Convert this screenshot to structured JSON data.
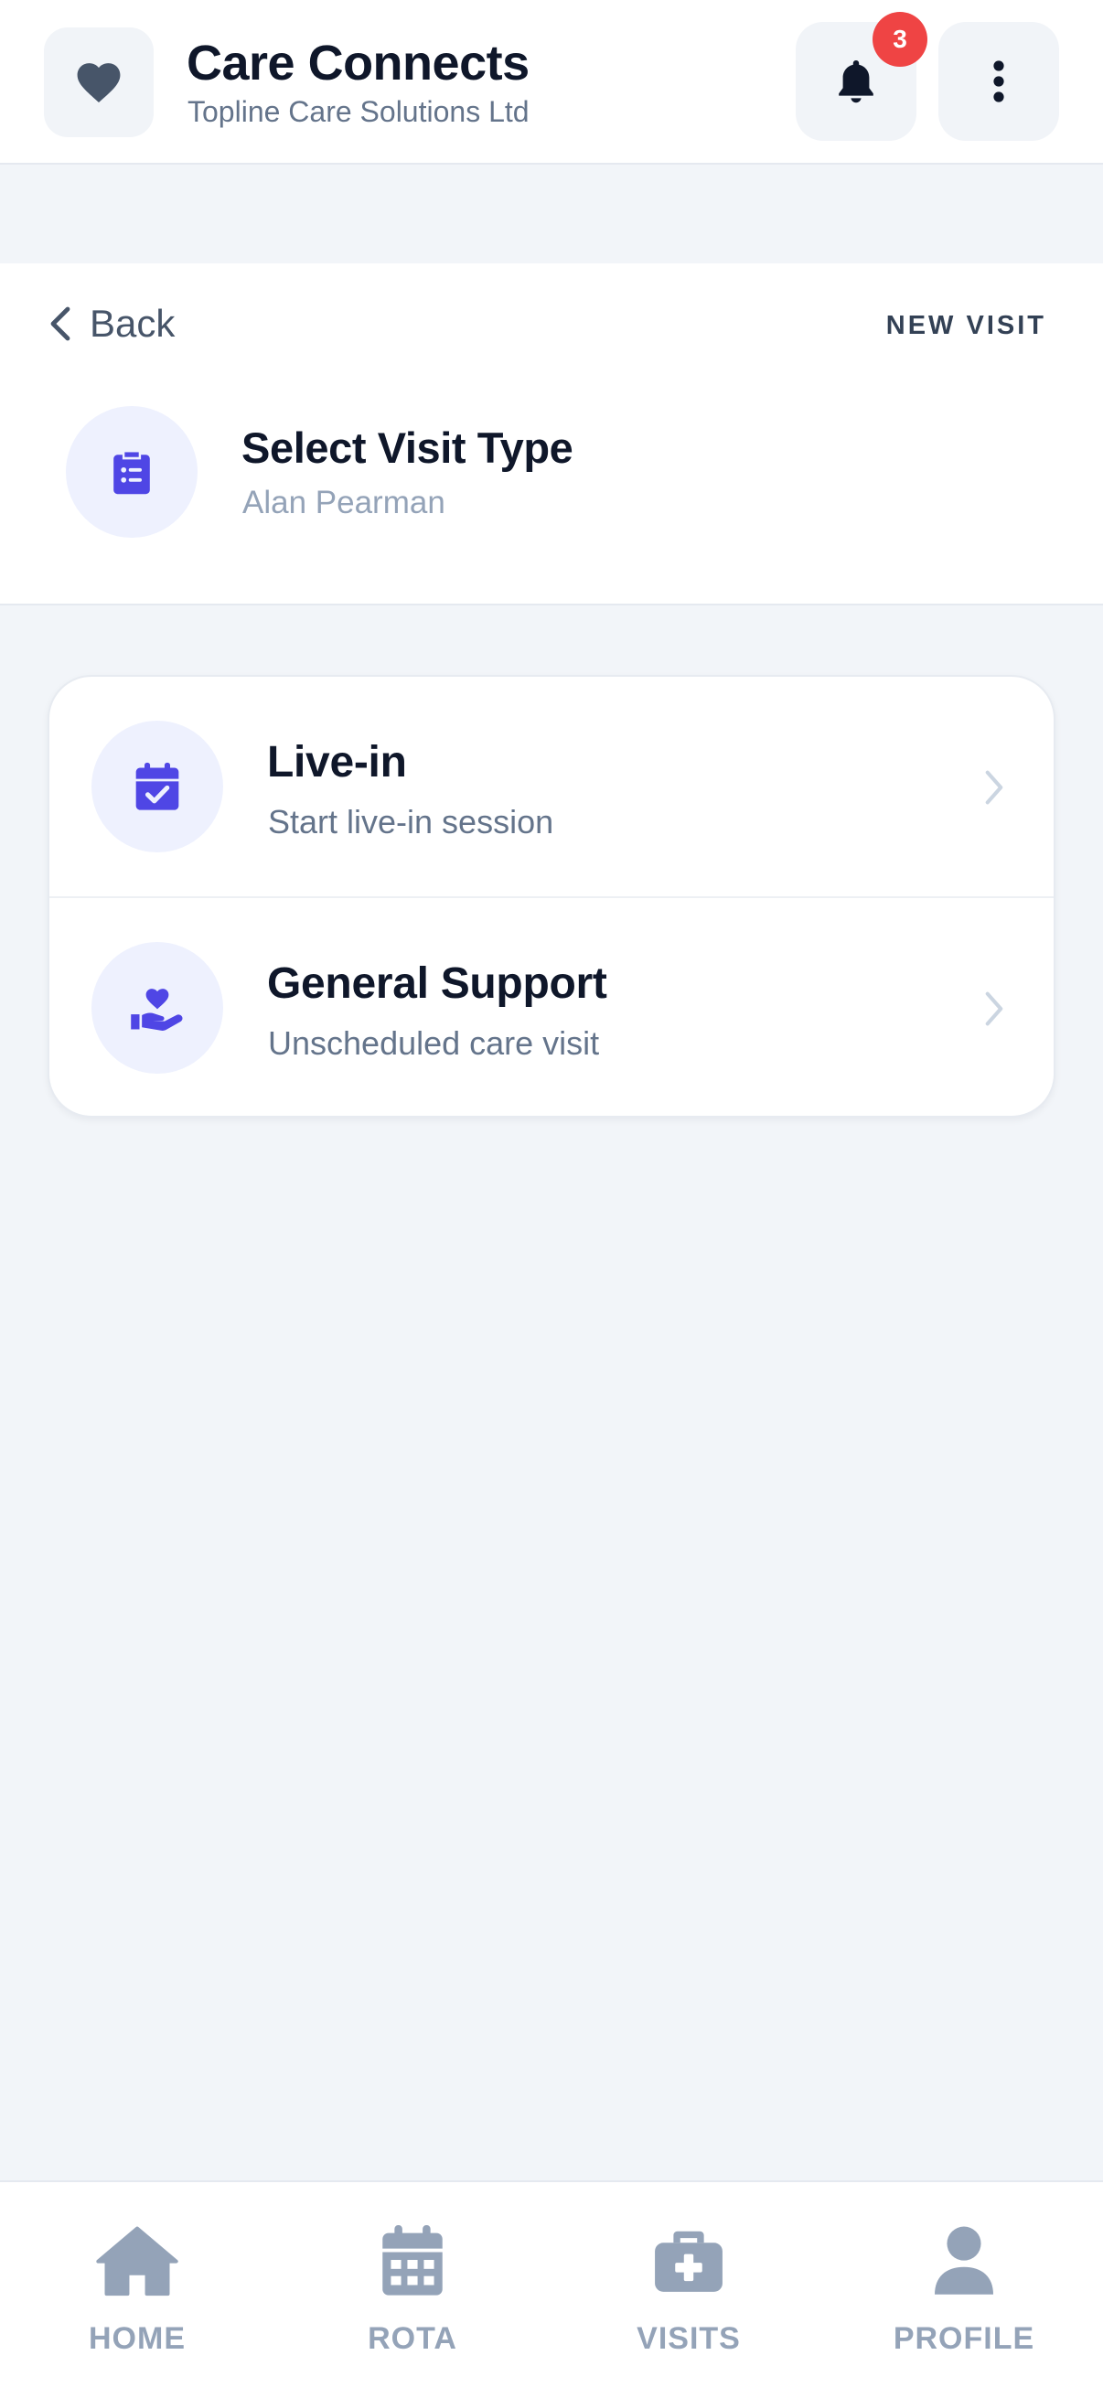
{
  "app": {
    "title": "Care Connects",
    "subtitle": "Topline Care Solutions Ltd",
    "notification_count": "3",
    "logo_icon": "heart-icon"
  },
  "page": {
    "back_label": "Back",
    "tag": "NEW VISIT",
    "title": "Select Visit Type",
    "client_name": "Alan Pearman",
    "header_icon": "clipboard-list-icon"
  },
  "options": [
    {
      "title": "Live-in",
      "subtitle": "Start live-in session",
      "icon": "calendar-check-icon"
    },
    {
      "title": "General Support",
      "subtitle": "Unscheduled care visit",
      "icon": "hand-heart-icon"
    }
  ],
  "nav": {
    "home": "HOME",
    "rota": "ROTA",
    "visits": "VISITS",
    "profile": "PROFILE"
  },
  "colors": {
    "accent": "#4f46e5",
    "badge": "#ef4444",
    "nav_inactive": "#94a3b8",
    "background": "#f2f5f9"
  }
}
